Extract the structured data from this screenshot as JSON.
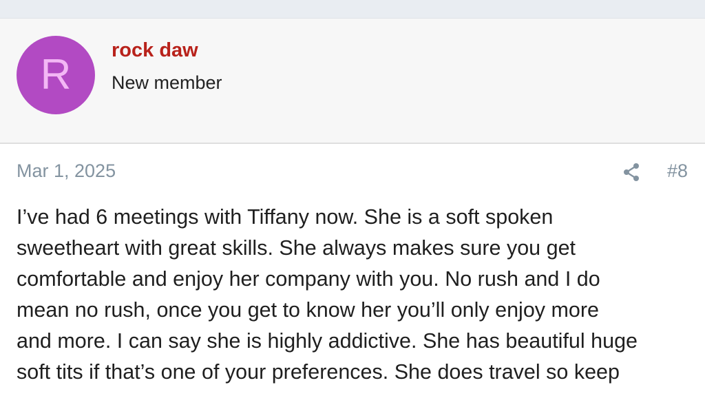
{
  "user": {
    "avatar_letter": "R",
    "name": "rock daw",
    "title": "New member",
    "avatar_color": "#b24ac3",
    "name_color": "#b8221b"
  },
  "post": {
    "date": "Mar 1, 2025",
    "number": "#8",
    "share_icon": "share-icon",
    "lines": [
      "I’ve had 6 meetings with Tiffany now. She is a soft spoken",
      "sweetheart with great skills. She always makes sure you get",
      "comfortable and enjoy her company with you. No rush and I do",
      "mean no rush, once you get to know her you’ll only enjoy more",
      "and more. I can say she is highly addictive. She has beautiful huge",
      "soft tits if that’s one of your preferences. She does travel so keep"
    ]
  }
}
